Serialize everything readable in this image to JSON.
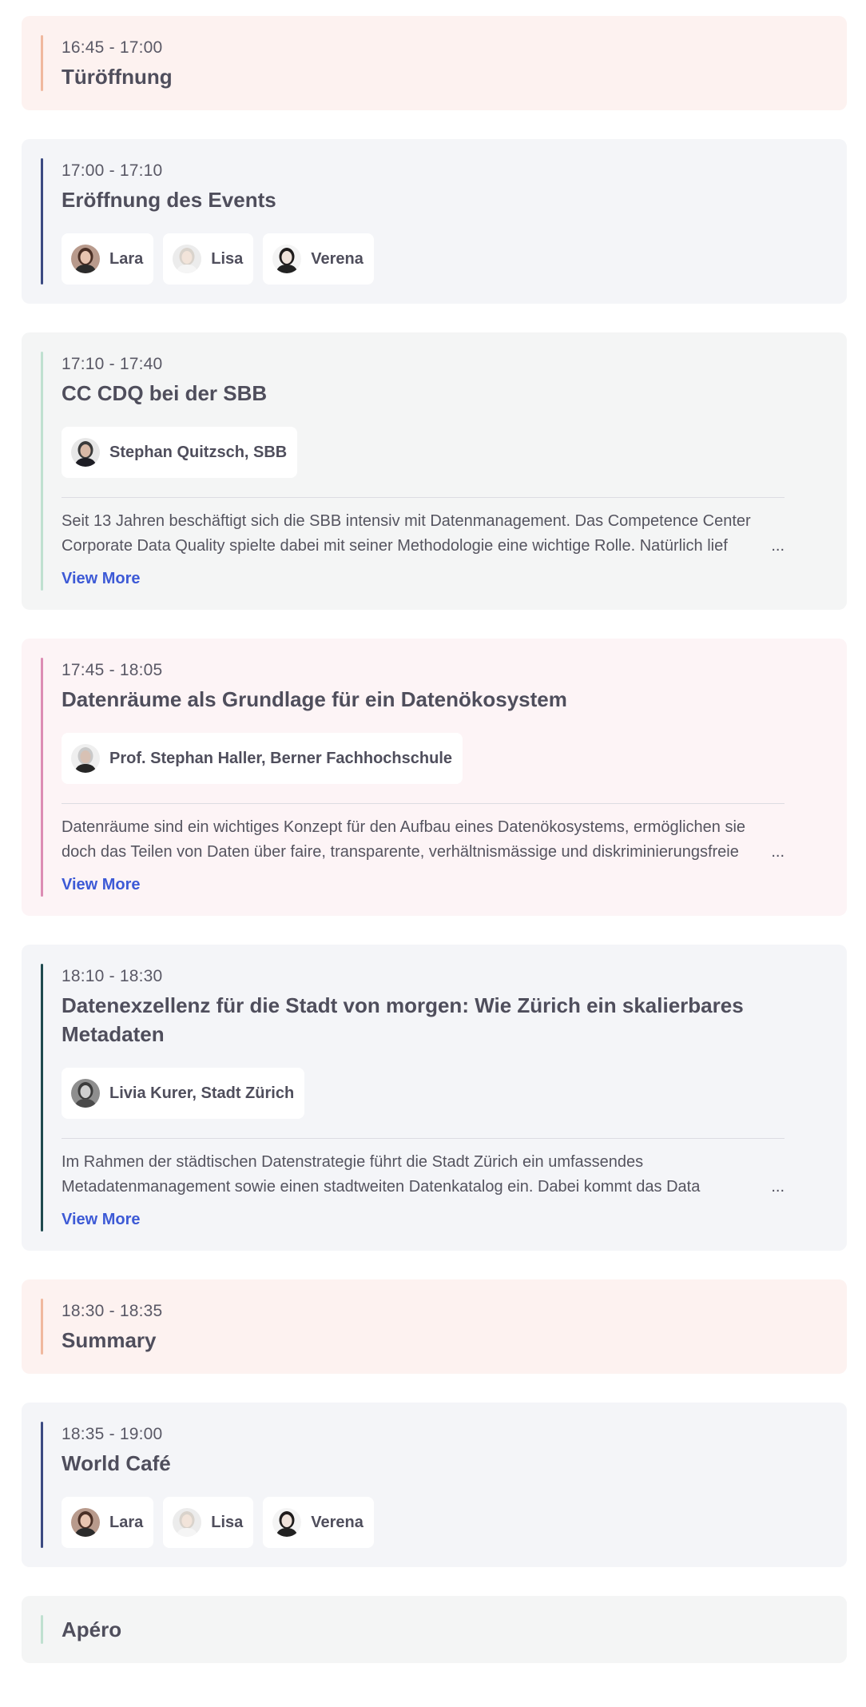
{
  "sessions": [
    {
      "time": "16:45 - 17:00",
      "title": "Türöffnung",
      "theme": {
        "bg": "#fdf2f0",
        "bar": "#f0b89e"
      },
      "speakers": [],
      "description": "",
      "view_more": ""
    },
    {
      "time": "17:00 - 17:10",
      "title": "Eröffnung des Events",
      "theme": {
        "bg": "#f4f5f8",
        "bar": "#3b4a82"
      },
      "speakers": [
        {
          "name": "Lara",
          "avatar": "avatar-lara"
        },
        {
          "name": "Lisa",
          "avatar": "avatar-lisa"
        },
        {
          "name": "Verena",
          "avatar": "avatar-verena"
        }
      ],
      "description": "",
      "view_more": ""
    },
    {
      "time": "17:10 - 17:40",
      "title": "CC CDQ bei der SBB",
      "theme": {
        "bg": "#f4f5f5",
        "bar": "#bfe0d0"
      },
      "speakers": [
        {
          "name": "Stephan Quitzsch, SBB",
          "avatar": "avatar-stephan-quitzsch"
        }
      ],
      "description": "Seit 13 Jahren beschäftigt sich die SBB intensiv mit Datenmanagement. Das Competence Center Corporate Data Quality spielte dabei mit seiner Methodologie eine wichtige Rolle. Natürlich lief",
      "view_more": "View More"
    },
    {
      "time": "17:45 - 18:05",
      "title": "Datenräume als Grundlage für ein Datenökosystem",
      "theme": {
        "bg": "#fdf4f6",
        "bar": "#dc8cb4"
      },
      "speakers": [
        {
          "name": "Prof. Stephan Haller, Berner Fachhochschule",
          "avatar": "avatar-stephan-haller"
        }
      ],
      "description": "Datenräume sind ein wichtiges Konzept für den Aufbau eines Datenökosystems, ermöglichen sie doch das Teilen von Daten über faire, transparente, verhältnismässige und diskriminierungsfreie",
      "view_more": "View More"
    },
    {
      "time": "18:10 - 18:30",
      "title": "Datenexzellenz für die Stadt von morgen: Wie Zürich ein skalierbares Metadaten",
      "theme": {
        "bg": "#f4f5f8",
        "bar": "#1f4a4f"
      },
      "speakers": [
        {
          "name": "Livia Kurer, Stadt Zürich",
          "avatar": "avatar-livia-kurer"
        }
      ],
      "description": "Im Rahmen der städtischen Datenstrategie führt die Stadt Zürich ein umfassendes Metadatenmanagement sowie einen stadtweiten Datenkatalog ein. Dabei kommt das Data",
      "view_more": "View More"
    },
    {
      "time": "18:30 - 18:35",
      "title": "Summary",
      "theme": {
        "bg": "#fdf2f0",
        "bar": "#f0b89e"
      },
      "speakers": [],
      "description": "",
      "view_more": ""
    },
    {
      "time": "18:35 - 19:00",
      "title": "World Café",
      "theme": {
        "bg": "#f4f5f8",
        "bar": "#3b4a82"
      },
      "speakers": [
        {
          "name": "Lara",
          "avatar": "avatar-lara"
        },
        {
          "name": "Lisa",
          "avatar": "avatar-lisa"
        },
        {
          "name": "Verena",
          "avatar": "avatar-verena"
        }
      ],
      "description": "",
      "view_more": ""
    },
    {
      "time": "",
      "title": "Apéro",
      "theme": {
        "bg": "#f4f5f5",
        "bar": "#bfe0d0"
      },
      "speakers": [],
      "description": "",
      "view_more": ""
    }
  ],
  "ellipsis": "..."
}
